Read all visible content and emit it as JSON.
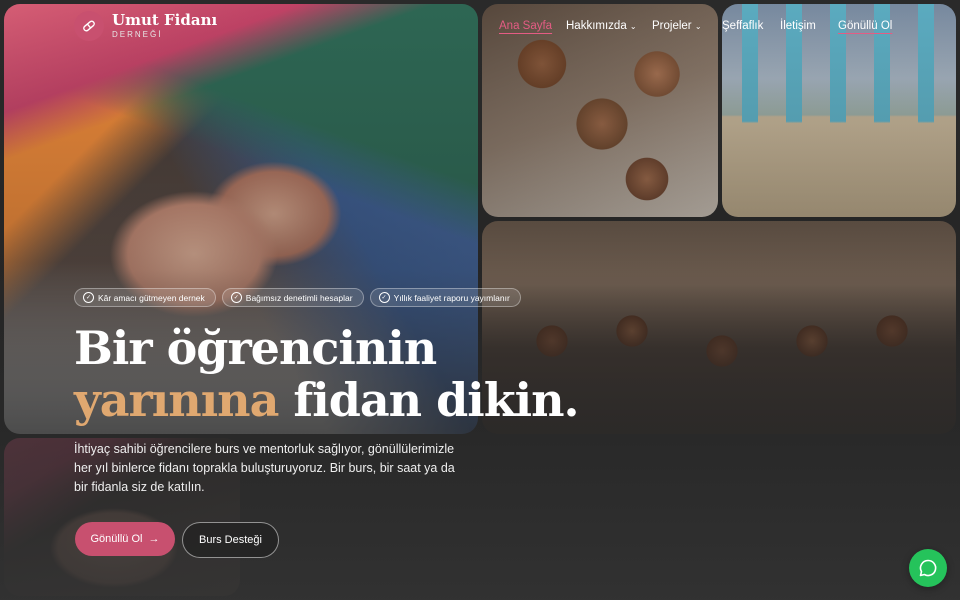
{
  "brand": {
    "name": "Umut Fidanı",
    "subtitle": "DERNEĞİ"
  },
  "nav": {
    "items": [
      {
        "label": "Ana Sayfa",
        "active": true
      },
      {
        "label": "Hakkımızda",
        "dropdown": true
      },
      {
        "label": "Projeler",
        "dropdown": true
      },
      {
        "label": "Şeffaflık"
      },
      {
        "label": "İletişim"
      },
      {
        "label": "Gönüllü Ol"
      }
    ]
  },
  "badges": [
    "Kâr amacı gütmeyen dernek",
    "Bağımsız denetimli hesaplar",
    "Yıllık faaliyet raporu yayımlanır"
  ],
  "hero": {
    "line1": "Bir öğrencinin",
    "accent": "yarınına",
    "line2_rest": " fidan dikin.",
    "description": "İhtiyaç sahibi öğrencilere burs ve mentorluk sağlıyor, gönüllülerimizle her yıl binlerce fidanı toprakla buluşturuyoruz. Bir burs, bir saat ya da bir fidanla siz de katılın."
  },
  "cta": {
    "primary": "Gönüllü Ol",
    "secondary": "Burs Desteği"
  },
  "colors": {
    "brand": "#c8506f",
    "accent": "#e0a870",
    "whatsapp": "#25c35b"
  },
  "icons": {
    "logo": "leaf-pill-icon",
    "check": "check-circle-icon",
    "arrow": "arrow-right-icon",
    "chat": "whatsapp-icon"
  }
}
